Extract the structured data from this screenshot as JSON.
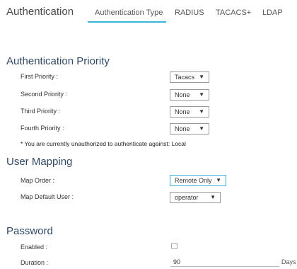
{
  "header": {
    "title": "Authentication"
  },
  "tabs": [
    {
      "label": "Authentication Type",
      "active": true
    },
    {
      "label": "RADIUS",
      "active": false
    },
    {
      "label": "TACACS+",
      "active": false
    },
    {
      "label": "LDAP",
      "active": false
    }
  ],
  "auth_priority": {
    "title": "Authentication Priority",
    "rows": [
      {
        "label": "First Priority :",
        "value": "Tacacs"
      },
      {
        "label": "Second Priority :",
        "value": "None"
      },
      {
        "label": "Third Priority :",
        "value": "None"
      },
      {
        "label": "Fourth Priority :",
        "value": "None"
      }
    ],
    "note": "* You are currently unauthorized to authenticate against: Local"
  },
  "user_mapping": {
    "title": "User Mapping",
    "map_order_label": "Map Order :",
    "map_order_value": "Remote Only",
    "map_default_label": "Map Default User :",
    "map_default_value": "operator"
  },
  "password": {
    "title": "Password",
    "enabled_label": "Enabled :",
    "enabled": false,
    "duration_label": "Duration :",
    "duration_value": "90",
    "duration_unit": "Days"
  },
  "colors": {
    "accent": "#3bb5d6",
    "section_title": "#2f4a68"
  },
  "icons": {
    "dropdown": "triangle-down-icon"
  }
}
